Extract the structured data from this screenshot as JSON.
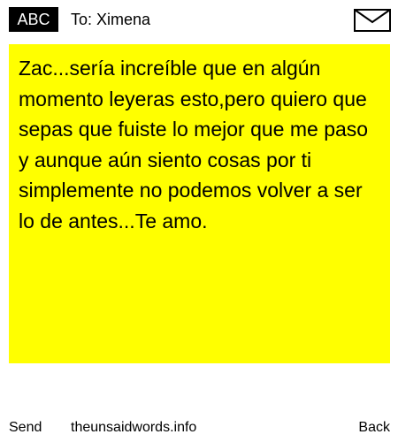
{
  "header": {
    "input_mode": "ABC",
    "recipient": "To: Ximena",
    "envelope_icon": "envelope-icon"
  },
  "message": {
    "text": "Zac...sería increíble que en algún momento leyeras esto,pero quiero que sepas que fuiste lo mejor que me paso y aunque aún siento cosas por ti simplemente no podemos volver a ser lo de antes...Te amo.",
    "background_color": "#ffff00"
  },
  "footer": {
    "send_label": "Send",
    "site_label": "theunsaidwords.info",
    "back_label": "Back"
  }
}
